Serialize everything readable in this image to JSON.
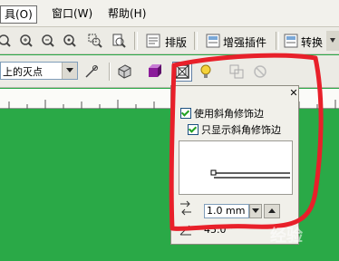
{
  "menubar": {
    "tools": "具(O)",
    "window": "窗口(W)",
    "help": "帮助(H)"
  },
  "toolbar": {
    "layout_label": "排版",
    "enhance_label": "增强插件",
    "convert_label": "转换"
  },
  "property_bar": {
    "vanishing_point_value": "上的灭点"
  },
  "popup": {
    "use_miter_label": "使用斜角修饰边",
    "only_show_miter_label": "只显示斜角修饰边",
    "miter_value": "1.0 mm",
    "angle_value": "45.0 °"
  },
  "watermark": "经验",
  "colors": {
    "canvas": "#2aa947",
    "highlight": "#e8202a"
  }
}
